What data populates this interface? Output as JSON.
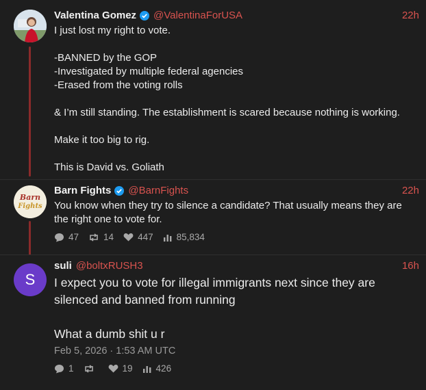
{
  "post1": {
    "name": "Valentina Gomez",
    "handle": "@ValentinaForUSA",
    "time": "22h",
    "text": "I just lost my right to vote.\n\n-BANNED by the GOP\n-Investigated by multiple federal agencies\n-Erased from the voting rolls\n\n& I’m still standing. The establishment is scared because nothing is working.\n\nMake it too big to rig.\n\nThis is David vs. Goliath"
  },
  "post2": {
    "name": "Barn Fights",
    "handle": "@BarnFights",
    "time": "22h",
    "avatar_text": "Barn Fights",
    "text": "You know when they try to silence a candidate? That usually means they are the right one to vote for.",
    "replies": "47",
    "reposts": "14",
    "likes": "447",
    "views": "85,834"
  },
  "post3": {
    "name": "suli",
    "handle": "@boltxRUSH3",
    "time": "16h",
    "avatar_letter": "S",
    "text": "I expect you to vote for illegal immigrants next since they are silenced and banned from running\n\nWhat a dumb shit u r",
    "date": "Feb 5, 2026 · 1:53 AM UTC",
    "replies": "1",
    "reposts": "",
    "likes": "19",
    "views": "426"
  },
  "colors": {
    "accent": "#d9534f",
    "thread": "#8a2a2a",
    "verified": "#1d9bf0",
    "avatar_s": "#6a3bc9"
  }
}
